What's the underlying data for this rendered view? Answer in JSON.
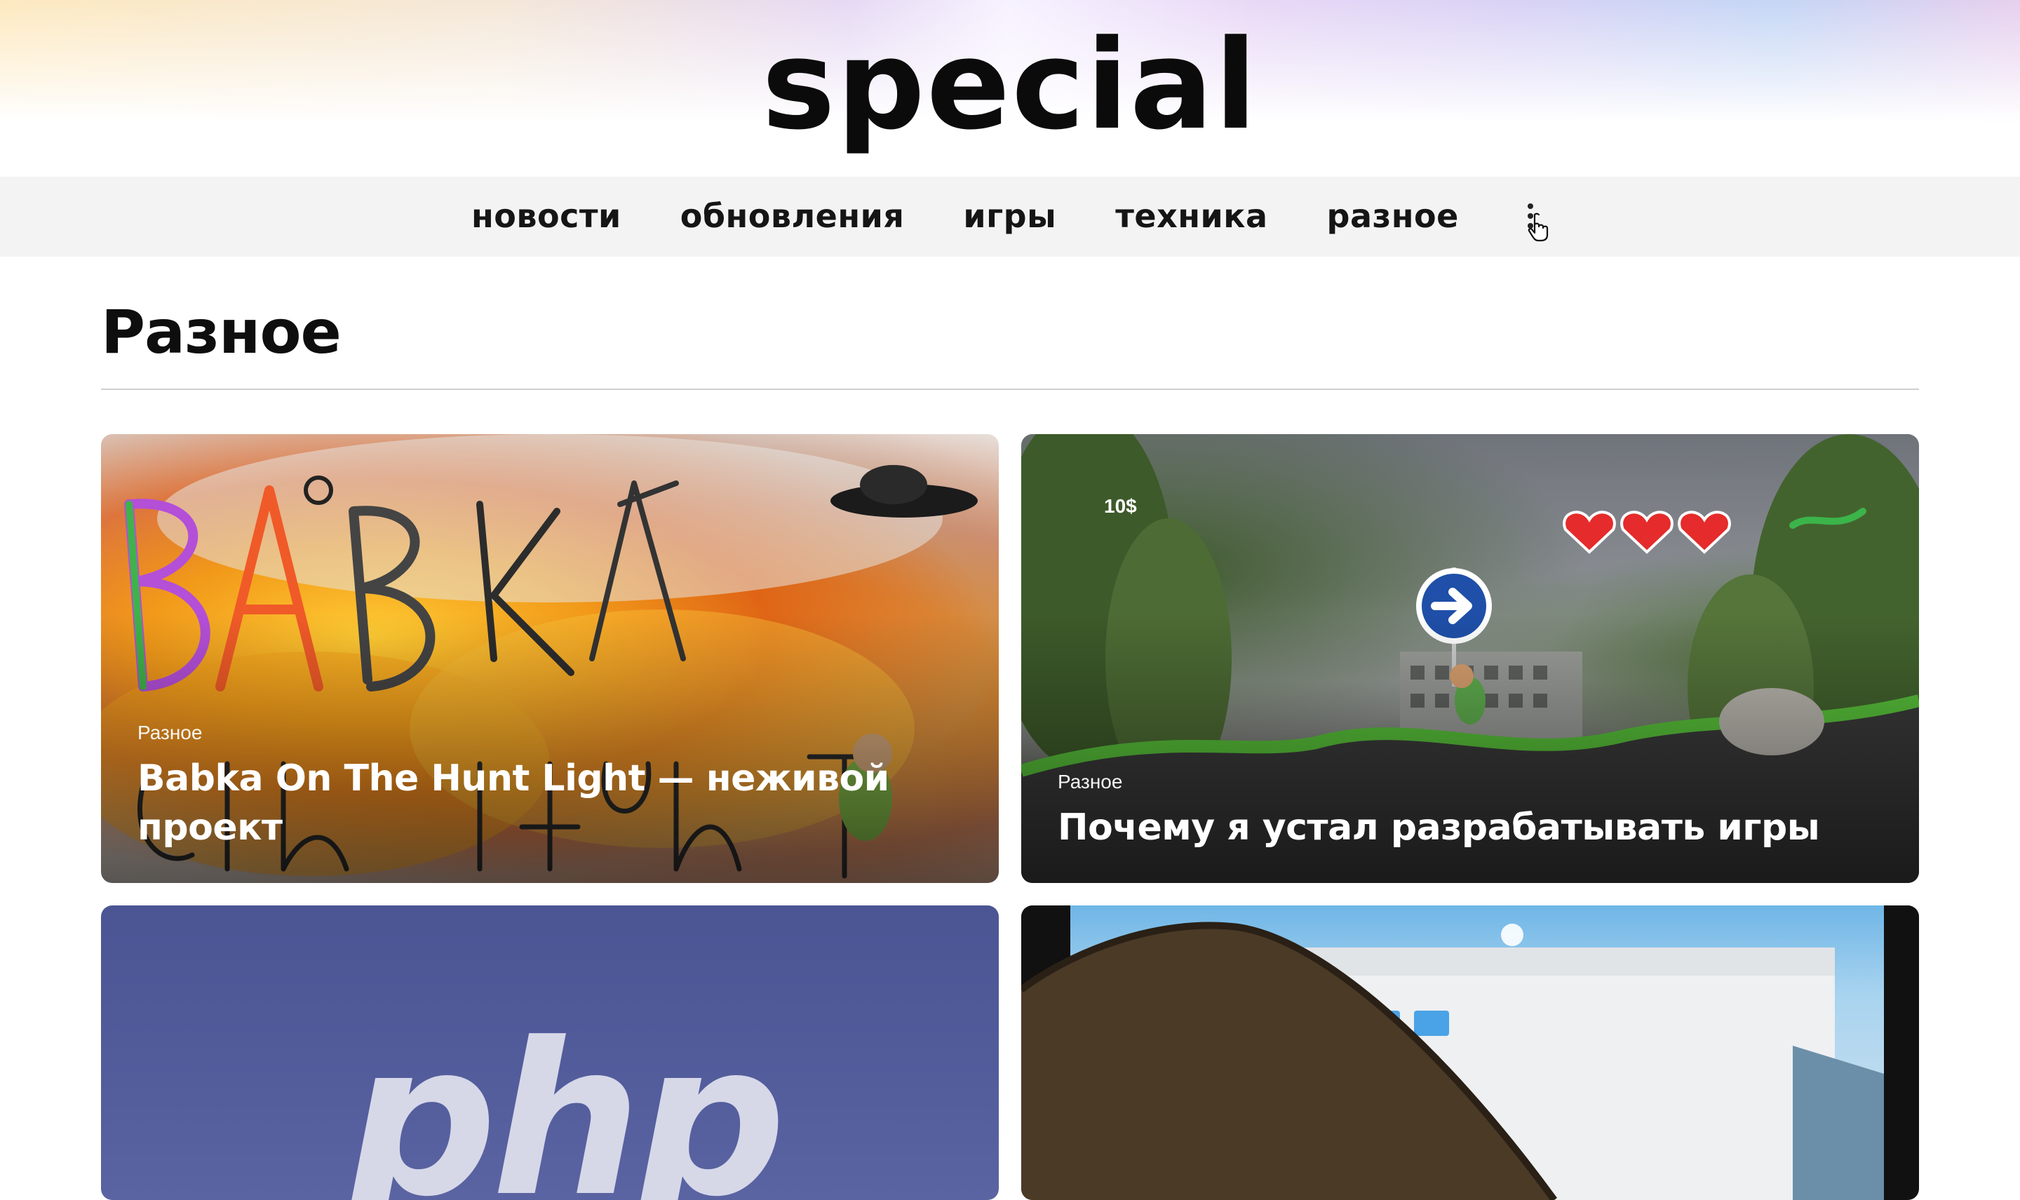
{
  "site": {
    "logo": "special"
  },
  "nav": {
    "items": [
      {
        "label": "новости"
      },
      {
        "label": "обновления"
      },
      {
        "label": "игры"
      },
      {
        "label": "техника"
      },
      {
        "label": "разное"
      }
    ],
    "more_icon": "more-vertical-icon"
  },
  "page": {
    "title": "Разное"
  },
  "cards": [
    {
      "category": "Разное",
      "title": "Babka On The Hunt Light — неживой проект"
    },
    {
      "category": "Разное",
      "title": "Почему я устал разрабатывать игры",
      "image_text": {
        "money": "10$"
      }
    },
    {
      "image_text": {
        "logo": "php"
      }
    },
    {}
  ],
  "colors": {
    "nav_bg": "#f3f3f3",
    "php_bg": "#4b5594",
    "text": "#111111"
  }
}
